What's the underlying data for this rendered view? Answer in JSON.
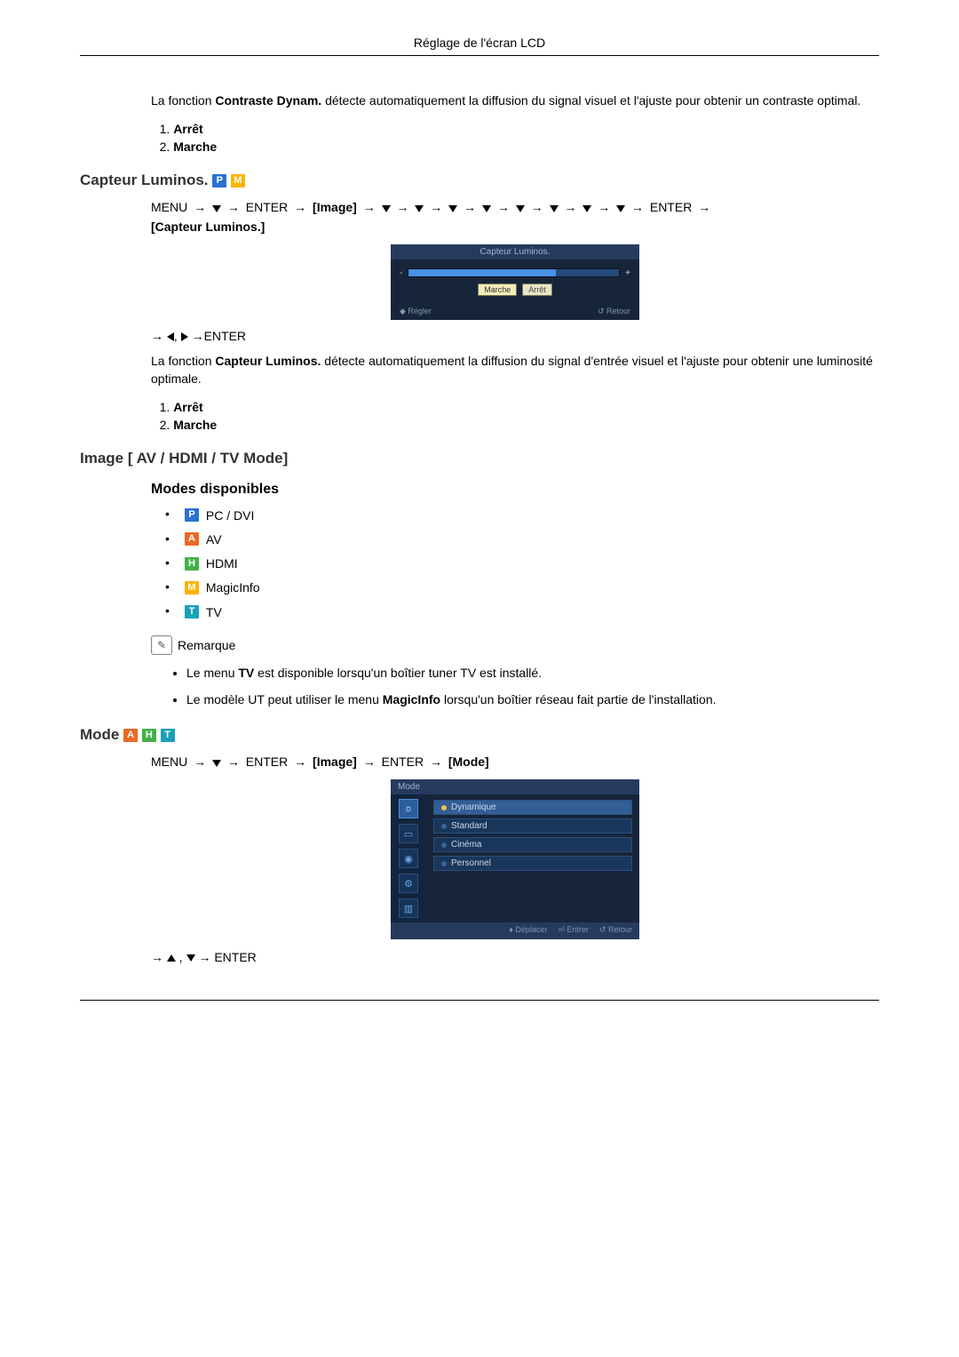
{
  "page_header": "Réglage de l'écran LCD",
  "section1": {
    "body_plain_pre": "La fonction ",
    "body_bold": "Contraste Dynam.",
    "body_plain_post": " détecte automatiquement la diffusion du signal visuel et l'ajuste pour obtenir un contraste optimal.",
    "options": {
      "o1": "Arrêt",
      "o2": "Marche"
    }
  },
  "section2": {
    "title": "Capteur Luminos.",
    "menu_path": {
      "menu": "MENU",
      "enter": "ENTER",
      "image": "[Image]",
      "target": "[Capteur Luminos.]",
      "arrow": "→"
    },
    "osd": {
      "title": "Capteur Luminos.",
      "btn_on": "Marche",
      "btn_off": "Arrêt",
      "foot_left": "Régler",
      "foot_right": "Retour",
      "minus": "-",
      "plus": "+",
      "slider_pct": 70,
      "arrow": "→"
    },
    "nav_enter": "ENTER",
    "body_pre": "La fonction ",
    "body_bold": "Capteur Luminos.",
    "body_post": " détecte automatiquement la diffusion du signal d'entrée visuel et l'ajuste pour obtenir une luminosité optimale.",
    "options": {
      "o1": "Arrêt",
      "o2": "Marche"
    }
  },
  "section3": {
    "title": "Image [ AV / HDMI / TV Mode]",
    "subtitle": "Modes disponibles",
    "modes": {
      "p": {
        "badge": "P",
        "label": "PC / DVI"
      },
      "a": {
        "badge": "A",
        "label": "AV"
      },
      "h": {
        "badge": "H",
        "label": "HDMI"
      },
      "m": {
        "badge": "M",
        "label": "MagicInfo"
      },
      "t": {
        "badge": "T",
        "label": "TV"
      }
    },
    "note_title": "Remarque",
    "note1_pre": "Le menu ",
    "note1_bold": "TV",
    "note1_post": " est disponible lorsqu'un boîtier tuner TV est installé.",
    "note2_pre": "Le modèle UT peut utiliser le menu ",
    "note2_bold": "MagicInfo",
    "note2_post": " lorsqu'un boîtier réseau fait partie de l'installation."
  },
  "section4": {
    "title": "Mode",
    "menu_path": {
      "menu": "MENU",
      "enter": "ENTER",
      "image": "[Image]",
      "mode": "[Mode]",
      "arrow": "→"
    },
    "osd": {
      "title": "Mode",
      "opts": {
        "o1": "Dynamique",
        "o2": "Standard",
        "o3": "Cinéma",
        "o4": "Personnel"
      },
      "foot_move": "Déplacer",
      "foot_enter": "Entrer",
      "foot_return": "Retour"
    },
    "nav_enter": "ENTER",
    "arrow": "→"
  },
  "badges": {
    "P": "P",
    "M": "M",
    "A": "A",
    "H": "H",
    "T": "T"
  }
}
